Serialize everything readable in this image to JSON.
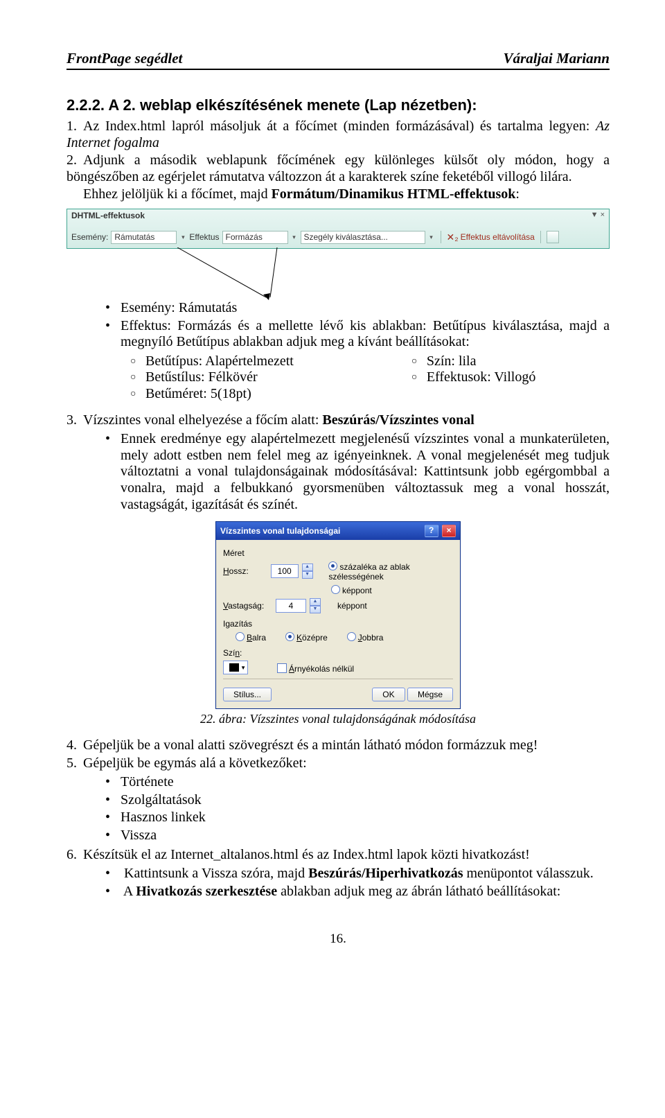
{
  "header": {
    "left": "FrontPage segédlet",
    "right": "Váraljai Mariann"
  },
  "heading": "2.2.2. A 2. weblap elkészítésének menete (Lap nézetben):",
  "step1": {
    "num": "1.",
    "lead": "Az Index.html lapról másoljuk át a főcímet (minden formázásával) és tartalma legyen: ",
    "italic": "Az Internet fogalma"
  },
  "step2": {
    "num": "2.",
    "p1": "Adjunk a második weblapunk főcímének egy különleges külsőt oly módon, hogy a böngészőben az egérjelet rámutatva változzon át a karakterek színe feketéből villogó lilára.",
    "p2_lead": "Ehhez jelöljük ki a főcímet, majd ",
    "p2_bold": "Formátum/Dinamikus HTML-effektusok",
    "p2_tail": ":"
  },
  "toolbar": {
    "title": "DHTML-effektusok",
    "close": "▼  ×",
    "esemeny_lbl": "Esemény:",
    "esemeny_val": "Rámutatás",
    "effektus_lbl": "Effektus",
    "effektus_val": "Formázás",
    "szegely_val": "Szegély kiválasztása...",
    "remove": "Effektus eltávolítása"
  },
  "bullets_after_toolbar": {
    "b1": "Esemény: Rámutatás",
    "b2": "Effektus: Formázás és a mellette lévő kis ablakban: Betűtípus kiválasztása, majd a megnyíló Betűtípus ablakban adjuk meg a kívánt beállításokat:"
  },
  "circ": {
    "left": {
      "c1": "Betűtípus: Alapértelmezett",
      "c2": "Betűstílus: Félkövér",
      "c3": "Betűméret: 5(18pt)"
    },
    "right": {
      "c1": "Szín: lila",
      "c2": "Effektusok: Villogó"
    }
  },
  "step3": {
    "num": "3.",
    "lead": "Vízszintes vonal elhelyezése a főcím alatt: ",
    "bold": "Beszúrás/Vízszintes vonal",
    "bullet": "Ennek eredménye egy alapértelmezett megjelenésű vízszintes vonal a munkaterületen, mely adott estben nem felel meg az igényeinknek. A vonal megjelenését meg tudjuk változtatni a vonal tulajdonságainak módosításával: Kattintsunk jobb egérgombbal a vonalra, majd a felbukkanó gyorsmenüben változtassuk meg a vonal hosszát, vastagságát, igazítását és színét."
  },
  "dialog": {
    "title": "Vízszintes vonal tulajdonságai",
    "grp_meret": "Méret",
    "hossz_lbl": "Hossz:",
    "hossz_val": "100",
    "rad_szazalek": "százaléka az ablak szélességének",
    "rad_keppont1": "képpont",
    "vastag_lbl": "Vastagság:",
    "vastag_val": "4",
    "vastag_unit": "képpont",
    "grp_igazitas": "Igazítás",
    "rad_balra": "Balra",
    "rad_kozepre": "Középre",
    "rad_jobbra": "Jobbra",
    "grp_szin": "Szín:",
    "chk_arnyek": "Árnyékolás nélkül",
    "btn_stilus": "Stílus...",
    "btn_ok": "OK",
    "btn_megse": "Mégse"
  },
  "caption": "22. ábra: Vízszintes vonal tulajdonságának módosítása",
  "step4": {
    "num": "4.",
    "text": "Gépeljük be a vonal alatti szövegrészt és a mintán látható módon formázzuk meg!"
  },
  "step5": {
    "num": "5.",
    "text": "Gépeljük be egymás alá a következőket:",
    "items": {
      "a": "Története",
      "b": "Szolgáltatások",
      "c": "Hasznos linkek",
      "d": "Vissza"
    }
  },
  "step6": {
    "num": "6.",
    "text": "Készítsük el az Internet_altalanos.html és az Index.html lapok közti hivatkozást!",
    "b1_a": "Kattintsunk a Vissza szóra, majd ",
    "b1_b": "Beszúrás/Hiperhivatkozás",
    "b1_c": " menüpontot válasszuk.",
    "b2_a": "A ",
    "b2_b": "Hivatkozás szerkesztése",
    "b2_c": " ablakban adjuk meg az ábrán látható beállításokat:"
  },
  "pagenum": "16."
}
